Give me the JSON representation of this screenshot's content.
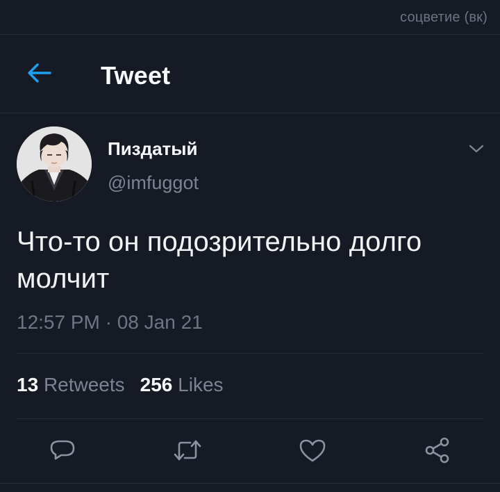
{
  "watermark": "соцветие (вк)",
  "header": {
    "title": "Tweet",
    "back_icon": "arrow-left-icon"
  },
  "tweet": {
    "author": {
      "display_name": "Пиздатый",
      "handle": "@imfuggot",
      "avatar": "profile-photo"
    },
    "text": "Что-то он подозрительно долго молчит",
    "timestamp": "12:57 PM · 08 Jan 21",
    "stats": {
      "retweets_count": "13",
      "retweets_label": "Retweets",
      "likes_count": "256",
      "likes_label": "Likes"
    },
    "actions": [
      "reply-icon",
      "retweet-icon",
      "like-icon",
      "share-icon"
    ]
  },
  "colors": {
    "background": "#161a25",
    "accent": "#1da1f2",
    "text_primary": "#f1f3f5",
    "text_secondary": "#7a8591",
    "divider": "#2a303b"
  }
}
